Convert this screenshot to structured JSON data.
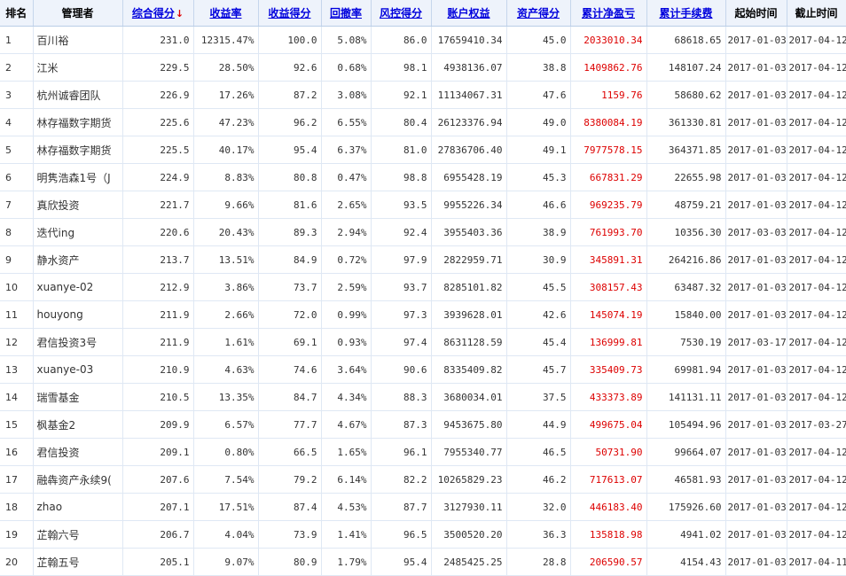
{
  "colors": {
    "header_bg": "#eef3fb",
    "link": "#0000dd",
    "profit_red": "#dd0000",
    "sort_arrow": "#e00000"
  },
  "headers": {
    "rank": "排名",
    "manager": "管理者",
    "composite_score": "综合得分",
    "sort_indicator": "↓",
    "return_rate": "收益率",
    "return_score": "收益得分",
    "drawdown": "回撤率",
    "risk_score": "风控得分",
    "equity": "账户权益",
    "asset_score": "资产得分",
    "net_pnl": "累计净盈亏",
    "fees": "累计手续费",
    "start_date": "起始时间",
    "end_date": "截止时间"
  },
  "rows": [
    {
      "rank": "1",
      "manager": "百川裕",
      "composite_score": "231.0",
      "return_rate": "12315.47%",
      "return_score": "100.0",
      "drawdown": "5.08%",
      "risk_score": "86.0",
      "equity": "17659410.34",
      "asset_score": "45.0",
      "net_pnl": "2033010.34",
      "fees": "68618.65",
      "start_date": "2017-01-03",
      "end_date": "2017-04-12"
    },
    {
      "rank": "2",
      "manager": "江米",
      "composite_score": "229.5",
      "return_rate": "28.50%",
      "return_score": "92.6",
      "drawdown": "0.68%",
      "risk_score": "98.1",
      "equity": "4938136.07",
      "asset_score": "38.8",
      "net_pnl": "1409862.76",
      "fees": "148107.24",
      "start_date": "2017-01-03",
      "end_date": "2017-04-12"
    },
    {
      "rank": "3",
      "manager": "杭州诚睿团队",
      "composite_score": "226.9",
      "return_rate": "17.26%",
      "return_score": "87.2",
      "drawdown": "3.08%",
      "risk_score": "92.1",
      "equity": "11134067.31",
      "asset_score": "47.6",
      "net_pnl": "1159.76",
      "fees": "58680.62",
      "start_date": "2017-01-03",
      "end_date": "2017-04-12"
    },
    {
      "rank": "4",
      "manager": "林存福数字期货",
      "composite_score": "225.6",
      "return_rate": "47.23%",
      "return_score": "96.2",
      "drawdown": "6.55%",
      "risk_score": "80.4",
      "equity": "26123376.94",
      "asset_score": "49.0",
      "net_pnl": "8380084.19",
      "fees": "361330.81",
      "start_date": "2017-01-03",
      "end_date": "2017-04-12"
    },
    {
      "rank": "5",
      "manager": "林存福数字期货",
      "composite_score": "225.5",
      "return_rate": "40.17%",
      "return_score": "95.4",
      "drawdown": "6.37%",
      "risk_score": "81.0",
      "equity": "27836706.40",
      "asset_score": "49.1",
      "net_pnl": "7977578.15",
      "fees": "364371.85",
      "start_date": "2017-01-03",
      "end_date": "2017-04-12"
    },
    {
      "rank": "6",
      "manager": "明隽浩森1号（J",
      "composite_score": "224.9",
      "return_rate": "8.83%",
      "return_score": "80.8",
      "drawdown": "0.47%",
      "risk_score": "98.8",
      "equity": "6955428.19",
      "asset_score": "45.3",
      "net_pnl": "667831.29",
      "fees": "22655.98",
      "start_date": "2017-01-03",
      "end_date": "2017-04-12"
    },
    {
      "rank": "7",
      "manager": "真欣投资",
      "composite_score": "221.7",
      "return_rate": "9.66%",
      "return_score": "81.6",
      "drawdown": "2.65%",
      "risk_score": "93.5",
      "equity": "9955226.34",
      "asset_score": "46.6",
      "net_pnl": "969235.79",
      "fees": "48759.21",
      "start_date": "2017-01-03",
      "end_date": "2017-04-12"
    },
    {
      "rank": "8",
      "manager": "迭代ing",
      "composite_score": "220.6",
      "return_rate": "20.43%",
      "return_score": "89.3",
      "drawdown": "2.94%",
      "risk_score": "92.4",
      "equity": "3955403.36",
      "asset_score": "38.9",
      "net_pnl": "761993.70",
      "fees": "10356.30",
      "start_date": "2017-03-03",
      "end_date": "2017-04-12"
    },
    {
      "rank": "9",
      "manager": "静水资产",
      "composite_score": "213.7",
      "return_rate": "13.51%",
      "return_score": "84.9",
      "drawdown": "0.72%",
      "risk_score": "97.9",
      "equity": "2822959.71",
      "asset_score": "30.9",
      "net_pnl": "345891.31",
      "fees": "264216.86",
      "start_date": "2017-01-03",
      "end_date": "2017-04-12"
    },
    {
      "rank": "10",
      "manager": "xuanye-02",
      "composite_score": "212.9",
      "return_rate": "3.86%",
      "return_score": "73.7",
      "drawdown": "2.59%",
      "risk_score": "93.7",
      "equity": "8285101.82",
      "asset_score": "45.5",
      "net_pnl": "308157.43",
      "fees": "63487.32",
      "start_date": "2017-01-03",
      "end_date": "2017-04-12"
    },
    {
      "rank": "11",
      "manager": "houyong",
      "composite_score": "211.9",
      "return_rate": "2.66%",
      "return_score": "72.0",
      "drawdown": "0.99%",
      "risk_score": "97.3",
      "equity": "3939628.01",
      "asset_score": "42.6",
      "net_pnl": "145074.19",
      "fees": "15840.00",
      "start_date": "2017-01-03",
      "end_date": "2017-04-12"
    },
    {
      "rank": "12",
      "manager": "君信投资3号",
      "composite_score": "211.9",
      "return_rate": "1.61%",
      "return_score": "69.1",
      "drawdown": "0.93%",
      "risk_score": "97.4",
      "equity": "8631128.59",
      "asset_score": "45.4",
      "net_pnl": "136999.81",
      "fees": "7530.19",
      "start_date": "2017-03-17",
      "end_date": "2017-04-12"
    },
    {
      "rank": "13",
      "manager": "xuanye-03",
      "composite_score": "210.9",
      "return_rate": "4.63%",
      "return_score": "74.6",
      "drawdown": "3.64%",
      "risk_score": "90.6",
      "equity": "8335409.82",
      "asset_score": "45.7",
      "net_pnl": "335409.73",
      "fees": "69981.94",
      "start_date": "2017-01-03",
      "end_date": "2017-04-12"
    },
    {
      "rank": "14",
      "manager": "瑞雪基金",
      "composite_score": "210.5",
      "return_rate": "13.35%",
      "return_score": "84.7",
      "drawdown": "4.34%",
      "risk_score": "88.3",
      "equity": "3680034.01",
      "asset_score": "37.5",
      "net_pnl": "433373.89",
      "fees": "141131.11",
      "start_date": "2017-01-03",
      "end_date": "2017-04-12"
    },
    {
      "rank": "15",
      "manager": "枫基金2",
      "composite_score": "209.9",
      "return_rate": "6.57%",
      "return_score": "77.7",
      "drawdown": "4.67%",
      "risk_score": "87.3",
      "equity": "9453675.80",
      "asset_score": "44.9",
      "net_pnl": "499675.04",
      "fees": "105494.96",
      "start_date": "2017-01-03",
      "end_date": "2017-03-27"
    },
    {
      "rank": "16",
      "manager": "君信投资",
      "composite_score": "209.1",
      "return_rate": "0.80%",
      "return_score": "66.5",
      "drawdown": "1.65%",
      "risk_score": "96.1",
      "equity": "7955340.77",
      "asset_score": "46.5",
      "net_pnl": "50731.90",
      "fees": "99664.07",
      "start_date": "2017-01-03",
      "end_date": "2017-04-12"
    },
    {
      "rank": "17",
      "manager": "融犇资产永续9(",
      "composite_score": "207.6",
      "return_rate": "7.54%",
      "return_score": "79.2",
      "drawdown": "6.14%",
      "risk_score": "82.2",
      "equity": "10265829.23",
      "asset_score": "46.2",
      "net_pnl": "717613.07",
      "fees": "46581.93",
      "start_date": "2017-01-03",
      "end_date": "2017-04-12"
    },
    {
      "rank": "18",
      "manager": "zhao",
      "composite_score": "207.1",
      "return_rate": "17.51%",
      "return_score": "87.4",
      "drawdown": "4.53%",
      "risk_score": "87.7",
      "equity": "3127930.11",
      "asset_score": "32.0",
      "net_pnl": "446183.40",
      "fees": "175926.60",
      "start_date": "2017-01-03",
      "end_date": "2017-04-12"
    },
    {
      "rank": "19",
      "manager": "芷翰六号",
      "composite_score": "206.7",
      "return_rate": "4.04%",
      "return_score": "73.9",
      "drawdown": "1.41%",
      "risk_score": "96.5",
      "equity": "3500520.20",
      "asset_score": "36.3",
      "net_pnl": "135818.98",
      "fees": "4941.02",
      "start_date": "2017-01-03",
      "end_date": "2017-04-12"
    },
    {
      "rank": "20",
      "manager": "芷翰五号",
      "composite_score": "205.1",
      "return_rate": "9.07%",
      "return_score": "80.9",
      "drawdown": "1.79%",
      "risk_score": "95.4",
      "equity": "2485425.25",
      "asset_score": "28.8",
      "net_pnl": "206590.57",
      "fees": "4154.43",
      "start_date": "2017-01-03",
      "end_date": "2017-04-11"
    }
  ]
}
